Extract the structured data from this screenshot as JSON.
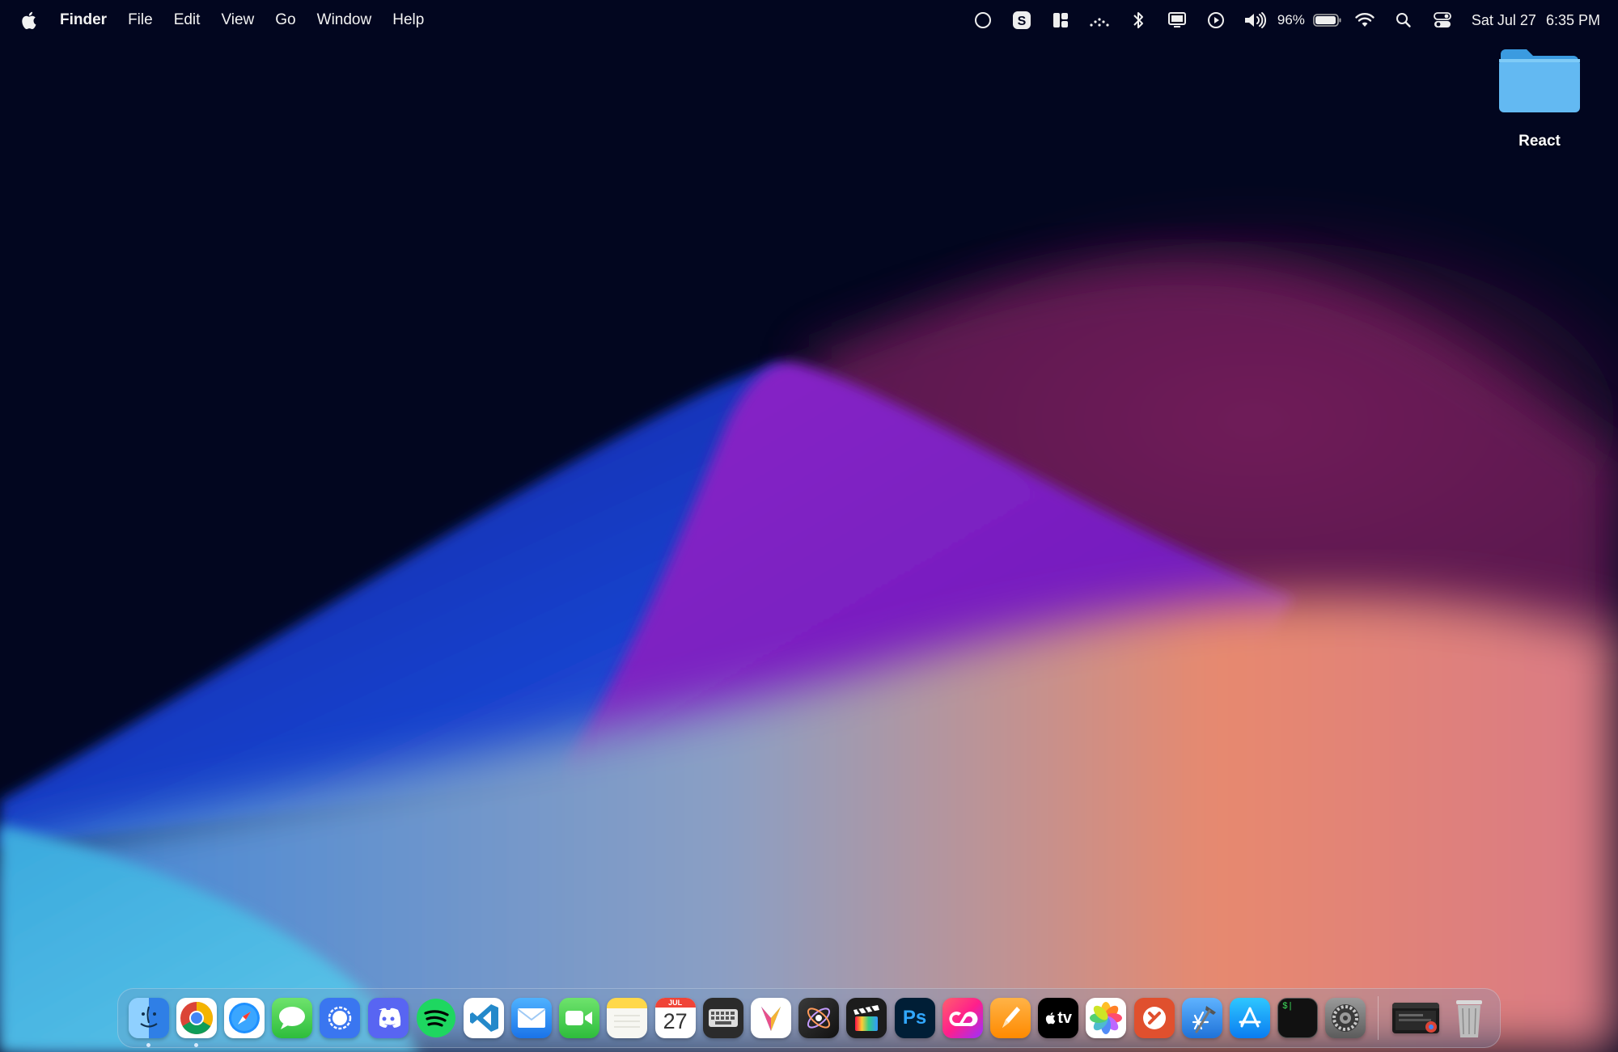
{
  "menubar": {
    "app_name": "Finder",
    "menus": [
      "File",
      "Edit",
      "View",
      "Go",
      "Window",
      "Help"
    ],
    "status_icons": [
      "moon-clock-icon",
      "s-badge-icon",
      "window-layout-icon",
      "dots-wave-icon",
      "bluetooth-icon",
      "display-icon",
      "play-circle-icon",
      "volume-icon"
    ],
    "battery_percent": "96%",
    "battery_level": 0.96,
    "date": "Sat Jul 27",
    "time": "6:35 PM"
  },
  "desktop": {
    "folders": [
      {
        "label": "React",
        "icon": "folder-icon"
      }
    ]
  },
  "dock": {
    "apps": [
      {
        "name": "finder",
        "icon": "finder-icon",
        "running": true
      },
      {
        "name": "chrome",
        "icon": "chrome-icon",
        "running": true
      },
      {
        "name": "safari",
        "icon": "safari-icon",
        "running": false
      },
      {
        "name": "messages",
        "icon": "messages-icon",
        "running": false
      },
      {
        "name": "signal",
        "icon": "signal-icon",
        "running": false
      },
      {
        "name": "discord",
        "icon": "discord-icon",
        "running": false
      },
      {
        "name": "spotify",
        "icon": "spotify-icon",
        "running": false
      },
      {
        "name": "vscode",
        "icon": "vscode-icon",
        "running": false
      },
      {
        "name": "mail",
        "icon": "mail-icon",
        "running": false
      },
      {
        "name": "facetime",
        "icon": "facetime-icon",
        "running": false
      },
      {
        "name": "notes",
        "icon": "notes-icon",
        "running": false
      },
      {
        "name": "calendar",
        "icon": "calendar-icon",
        "running": false,
        "month": "JUL",
        "day": "27"
      },
      {
        "name": "keyboard-viewer",
        "icon": "keyboard-icon",
        "running": false
      },
      {
        "name": "affinity",
        "icon": "affinity-icon",
        "running": false
      },
      {
        "name": "motion",
        "icon": "motion-icon",
        "running": false
      },
      {
        "name": "final-cut",
        "icon": "clapper-icon",
        "running": false
      },
      {
        "name": "photoshop",
        "icon": "photoshop-icon",
        "running": false,
        "text": "Ps"
      },
      {
        "name": "creative-cloud",
        "icon": "creative-cloud-icon",
        "running": false
      },
      {
        "name": "pages",
        "icon": "pencil-icon",
        "running": false
      },
      {
        "name": "apple-tv",
        "icon": "appletv-icon",
        "running": false,
        "text": "tv"
      },
      {
        "name": "photos",
        "icon": "photos-icon",
        "running": false
      },
      {
        "name": "remote-desktop",
        "icon": "remote-desktop-icon",
        "running": false
      },
      {
        "name": "xcode",
        "icon": "xcode-icon",
        "running": false
      },
      {
        "name": "app-store",
        "icon": "appstore-icon",
        "running": false
      },
      {
        "name": "terminal",
        "icon": "terminal-icon",
        "running": false,
        "text": "$|"
      },
      {
        "name": "system-settings",
        "icon": "gear-icon",
        "running": false
      }
    ],
    "extras": [
      {
        "name": "recent-window",
        "icon": "window-thumbnail-icon"
      },
      {
        "name": "trash",
        "icon": "trash-icon"
      }
    ]
  }
}
